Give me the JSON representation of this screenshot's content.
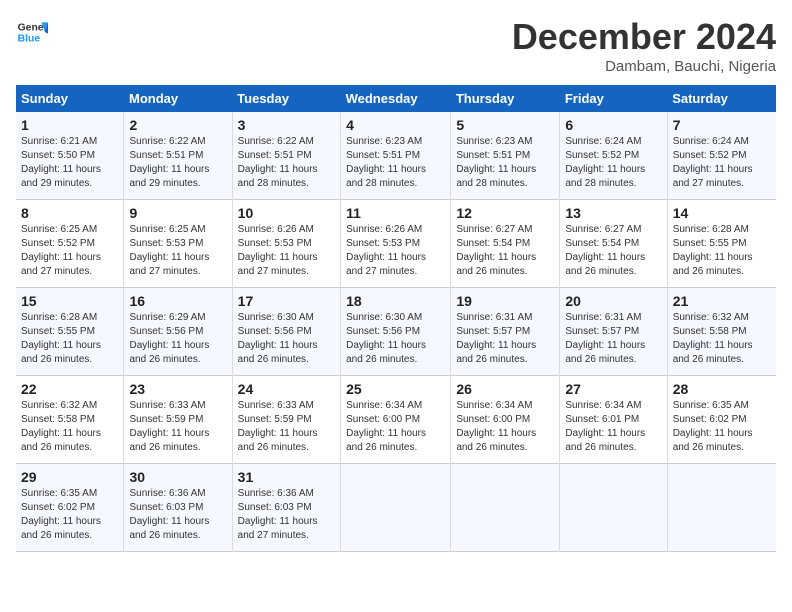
{
  "logo": {
    "line1": "General",
    "line2": "Blue"
  },
  "title": "December 2024",
  "subtitle": "Dambam, Bauchi, Nigeria",
  "columns": [
    "Sunday",
    "Monday",
    "Tuesday",
    "Wednesday",
    "Thursday",
    "Friday",
    "Saturday"
  ],
  "weeks": [
    [
      {
        "day": "1",
        "info": "Sunrise: 6:21 AM\nSunset: 5:50 PM\nDaylight: 11 hours\nand 29 minutes."
      },
      {
        "day": "2",
        "info": "Sunrise: 6:22 AM\nSunset: 5:51 PM\nDaylight: 11 hours\nand 29 minutes."
      },
      {
        "day": "3",
        "info": "Sunrise: 6:22 AM\nSunset: 5:51 PM\nDaylight: 11 hours\nand 28 minutes."
      },
      {
        "day": "4",
        "info": "Sunrise: 6:23 AM\nSunset: 5:51 PM\nDaylight: 11 hours\nand 28 minutes."
      },
      {
        "day": "5",
        "info": "Sunrise: 6:23 AM\nSunset: 5:51 PM\nDaylight: 11 hours\nand 28 minutes."
      },
      {
        "day": "6",
        "info": "Sunrise: 6:24 AM\nSunset: 5:52 PM\nDaylight: 11 hours\nand 28 minutes."
      },
      {
        "day": "7",
        "info": "Sunrise: 6:24 AM\nSunset: 5:52 PM\nDaylight: 11 hours\nand 27 minutes."
      }
    ],
    [
      {
        "day": "8",
        "info": "Sunrise: 6:25 AM\nSunset: 5:52 PM\nDaylight: 11 hours\nand 27 minutes."
      },
      {
        "day": "9",
        "info": "Sunrise: 6:25 AM\nSunset: 5:53 PM\nDaylight: 11 hours\nand 27 minutes."
      },
      {
        "day": "10",
        "info": "Sunrise: 6:26 AM\nSunset: 5:53 PM\nDaylight: 11 hours\nand 27 minutes."
      },
      {
        "day": "11",
        "info": "Sunrise: 6:26 AM\nSunset: 5:53 PM\nDaylight: 11 hours\nand 27 minutes."
      },
      {
        "day": "12",
        "info": "Sunrise: 6:27 AM\nSunset: 5:54 PM\nDaylight: 11 hours\nand 26 minutes."
      },
      {
        "day": "13",
        "info": "Sunrise: 6:27 AM\nSunset: 5:54 PM\nDaylight: 11 hours\nand 26 minutes."
      },
      {
        "day": "14",
        "info": "Sunrise: 6:28 AM\nSunset: 5:55 PM\nDaylight: 11 hours\nand 26 minutes."
      }
    ],
    [
      {
        "day": "15",
        "info": "Sunrise: 6:28 AM\nSunset: 5:55 PM\nDaylight: 11 hours\nand 26 minutes."
      },
      {
        "day": "16",
        "info": "Sunrise: 6:29 AM\nSunset: 5:56 PM\nDaylight: 11 hours\nand 26 minutes."
      },
      {
        "day": "17",
        "info": "Sunrise: 6:30 AM\nSunset: 5:56 PM\nDaylight: 11 hours\nand 26 minutes."
      },
      {
        "day": "18",
        "info": "Sunrise: 6:30 AM\nSunset: 5:56 PM\nDaylight: 11 hours\nand 26 minutes."
      },
      {
        "day": "19",
        "info": "Sunrise: 6:31 AM\nSunset: 5:57 PM\nDaylight: 11 hours\nand 26 minutes."
      },
      {
        "day": "20",
        "info": "Sunrise: 6:31 AM\nSunset: 5:57 PM\nDaylight: 11 hours\nand 26 minutes."
      },
      {
        "day": "21",
        "info": "Sunrise: 6:32 AM\nSunset: 5:58 PM\nDaylight: 11 hours\nand 26 minutes."
      }
    ],
    [
      {
        "day": "22",
        "info": "Sunrise: 6:32 AM\nSunset: 5:58 PM\nDaylight: 11 hours\nand 26 minutes."
      },
      {
        "day": "23",
        "info": "Sunrise: 6:33 AM\nSunset: 5:59 PM\nDaylight: 11 hours\nand 26 minutes."
      },
      {
        "day": "24",
        "info": "Sunrise: 6:33 AM\nSunset: 5:59 PM\nDaylight: 11 hours\nand 26 minutes."
      },
      {
        "day": "25",
        "info": "Sunrise: 6:34 AM\nSunset: 6:00 PM\nDaylight: 11 hours\nand 26 minutes."
      },
      {
        "day": "26",
        "info": "Sunrise: 6:34 AM\nSunset: 6:00 PM\nDaylight: 11 hours\nand 26 minutes."
      },
      {
        "day": "27",
        "info": "Sunrise: 6:34 AM\nSunset: 6:01 PM\nDaylight: 11 hours\nand 26 minutes."
      },
      {
        "day": "28",
        "info": "Sunrise: 6:35 AM\nSunset: 6:02 PM\nDaylight: 11 hours\nand 26 minutes."
      }
    ],
    [
      {
        "day": "29",
        "info": "Sunrise: 6:35 AM\nSunset: 6:02 PM\nDaylight: 11 hours\nand 26 minutes."
      },
      {
        "day": "30",
        "info": "Sunrise: 6:36 AM\nSunset: 6:03 PM\nDaylight: 11 hours\nand 26 minutes."
      },
      {
        "day": "31",
        "info": "Sunrise: 6:36 AM\nSunset: 6:03 PM\nDaylight: 11 hours\nand 27 minutes."
      },
      {
        "day": "",
        "info": ""
      },
      {
        "day": "",
        "info": ""
      },
      {
        "day": "",
        "info": ""
      },
      {
        "day": "",
        "info": ""
      }
    ]
  ]
}
